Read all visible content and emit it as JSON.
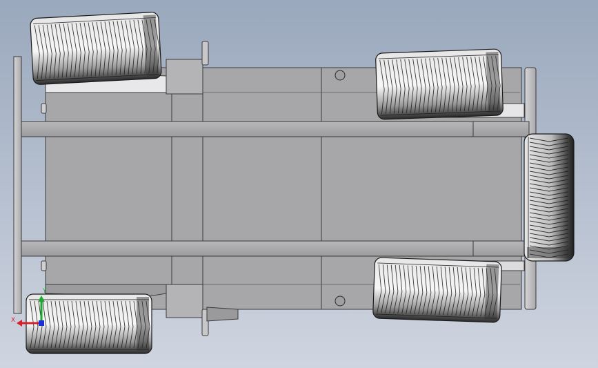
{
  "viewport": {
    "background_top": "#9aa8bd",
    "background_bottom": "#cfd5e0"
  },
  "colors": {
    "chassis_fill": "#a7a7a9",
    "panel_fill": "#b2b2b4",
    "rail_fill": "#a2a2a4",
    "bumper_fill": "#c4c4c6",
    "outline": "#3a3a3a",
    "tire_light": "#f2f2f2",
    "tire_dark": "#2e2e2e",
    "tread_stroke": "#1a1a1a"
  },
  "triad": {
    "x_label": "X",
    "y_label": "Y",
    "x_color": "#d8202a",
    "y_color": "#1ea82d",
    "z_color": "#1a2fd6"
  },
  "icons": {
    "triad": "coordinate-triad-icon"
  }
}
